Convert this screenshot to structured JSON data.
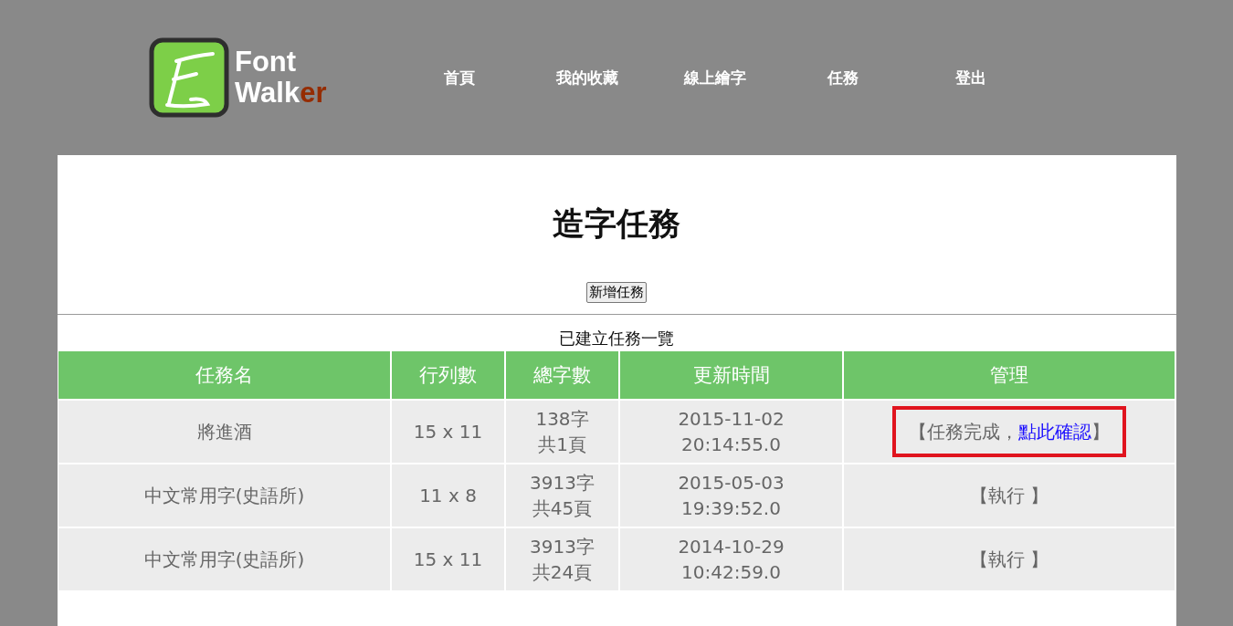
{
  "logo": {
    "line1": "Font",
    "line2": "Walk",
    "line2_accent": "er"
  },
  "nav": [
    "首頁",
    "我的收藏",
    "線上繪字",
    "任務",
    "登出"
  ],
  "title": "造字任務",
  "add_button": "新增任務",
  "list_caption": "已建立任務一覽",
  "table": {
    "columns": [
      "任務名",
      "行列數",
      "總字數",
      "更新時間",
      "管理"
    ],
    "rows": [
      {
        "name": "將進酒",
        "grid": "15 x 11",
        "count": [
          "138字",
          "共1頁"
        ],
        "updated": [
          "2015-11-02",
          "20:14:55.0"
        ],
        "manage": {
          "kind": "confirm",
          "prefix": "【任務完成，",
          "link": "點此確認",
          "suffix": "】"
        },
        "highlighted": true
      },
      {
        "name": "中文常用字(史語所)",
        "grid": "11 x 8",
        "count": [
          "3913字",
          "共45頁"
        ],
        "updated": [
          "2015-05-03",
          "19:39:52.0"
        ],
        "manage": {
          "kind": "action",
          "label": "【執行 】"
        },
        "highlighted": false
      },
      {
        "name": "中文常用字(史語所)",
        "grid": "15 x 11",
        "count": [
          "3913字",
          "共24頁"
        ],
        "updated": [
          "2014-10-29",
          "10:42:59.0"
        ],
        "manage": {
          "kind": "action",
          "label": "【執行 】"
        },
        "highlighted": false
      }
    ]
  }
}
